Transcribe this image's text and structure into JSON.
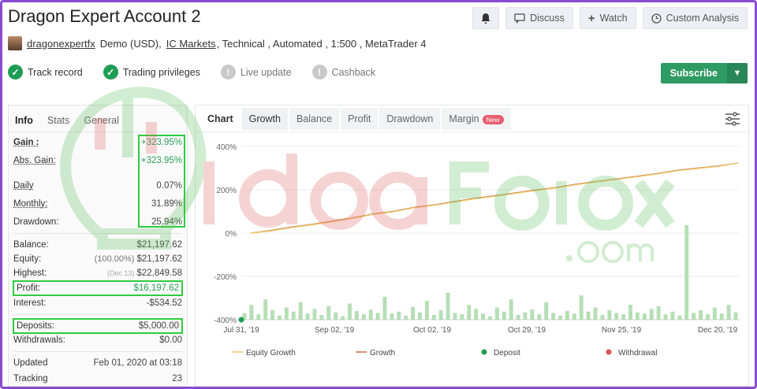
{
  "title": "Dragon Expert Account 2",
  "top_buttons": {
    "discuss": "Discuss",
    "watch": "Watch",
    "custom_analysis": "Custom Analysis"
  },
  "meta": {
    "username": "dragonexpertfx",
    "account_type": "Demo (USD),",
    "broker": "IC Markets",
    "details": ", Technical , Automated , 1:500 , MetaTrader 4"
  },
  "badges": {
    "track_record": "Track record",
    "trading_privileges": "Trading privileges",
    "live_update": "Live update",
    "cashback": "Cashback"
  },
  "subscribe": "Subscribe",
  "left_tabs": {
    "info": "Info",
    "stats": "Stats",
    "general": "General"
  },
  "stats": {
    "gain_label": "Gain :",
    "gain_value": "+323.95%",
    "abs_gain_label": "Abs. Gain:",
    "abs_gain_value": "+323.95%",
    "daily_label": "Daily",
    "daily_value": "0.07%",
    "monthly_label": "Monthly:",
    "monthly_value": "31.89%",
    "drawdown_label": "Drawdown:",
    "drawdown_value": "25.94%",
    "balance_label": "Balance:",
    "balance_value": "$21,197.62",
    "equity_label": "Equity:",
    "equity_pct": "(100.00%)",
    "equity_value": "$21,197.62",
    "highest_label": "Highest:",
    "highest_date": "(Dec 13)",
    "highest_value": "$22,849.58",
    "profit_label": "Profit:",
    "profit_value": "$16,197.62",
    "interest_label": "Interest:",
    "interest_value": "-$534.52",
    "deposits_label": "Deposits:",
    "deposits_value": "$5,000.00",
    "withdrawals_label": "Withdrawals:",
    "withdrawals_value": "$0.00",
    "updated_label": "Updated",
    "updated_value": "Feb 01, 2020 at 03:18",
    "tracking_label": "Tracking",
    "tracking_value": "23"
  },
  "chart_tabs": {
    "chart": "Chart",
    "growth": "Growth",
    "balance": "Balance",
    "profit": "Profit",
    "drawdown": "Drawdown",
    "margin": "Margin",
    "new_badge": "New"
  },
  "legend": {
    "equity_growth": "Equity Growth",
    "growth": "Growth",
    "deposit": "Deposit",
    "withdrawal": "Withdrawal"
  },
  "colors": {
    "accent": "#2e9b63",
    "equity": "#f0c96a",
    "growth": "#c0714a",
    "deposit": "#1f9d55",
    "withdrawal": "#e05050",
    "bars": "#a8d8a8"
  },
  "chart_data": {
    "type": "line",
    "x_tick_labels": [
      "Jul 31, '19",
      "Sep 02, '19",
      "Oct 02, '19",
      "Oct 29, '19",
      "Nov 25, '19",
      "Dec 20, '19"
    ],
    "y_tick_labels": [
      "400%",
      "200%",
      "0%",
      "-200%",
      "-400%"
    ],
    "ylim": [
      -400,
      400
    ],
    "series": [
      {
        "name": "Growth",
        "values": [
          0,
          12,
          28,
          40,
          55,
          70,
          88,
          100,
          118,
          130,
          145,
          160,
          172,
          185,
          198,
          210,
          225,
          238,
          250,
          262,
          275,
          290,
          300,
          310,
          323.95
        ]
      },
      {
        "name": "Equity Growth",
        "values": [
          0,
          10,
          26,
          38,
          52,
          68,
          86,
          98,
          116,
          128,
          143,
          158,
          170,
          183,
          196,
          208,
          223,
          236,
          248,
          260,
          273,
          288,
          298,
          308,
          323.95
        ]
      }
    ],
    "bars": [
      10,
      22,
      8,
      30,
      14,
      6,
      18,
      12,
      26,
      9,
      16,
      7,
      20,
      11,
      5,
      24,
      13,
      8,
      15,
      10,
      34,
      9,
      12,
      6,
      19,
      11,
      28,
      7,
      14,
      40,
      10,
      8,
      22,
      16,
      9,
      5,
      18,
      12,
      30,
      7,
      11,
      15,
      8,
      26,
      10,
      6,
      13,
      9,
      36,
      12,
      18,
      7,
      14,
      10,
      8,
      22,
      11,
      9,
      16,
      20,
      8,
      12,
      6,
      140,
      10,
      14,
      8,
      18,
      9,
      22,
      11
    ],
    "markers": [
      {
        "type": "deposit",
        "x": 0,
        "y": -400
      }
    ]
  }
}
